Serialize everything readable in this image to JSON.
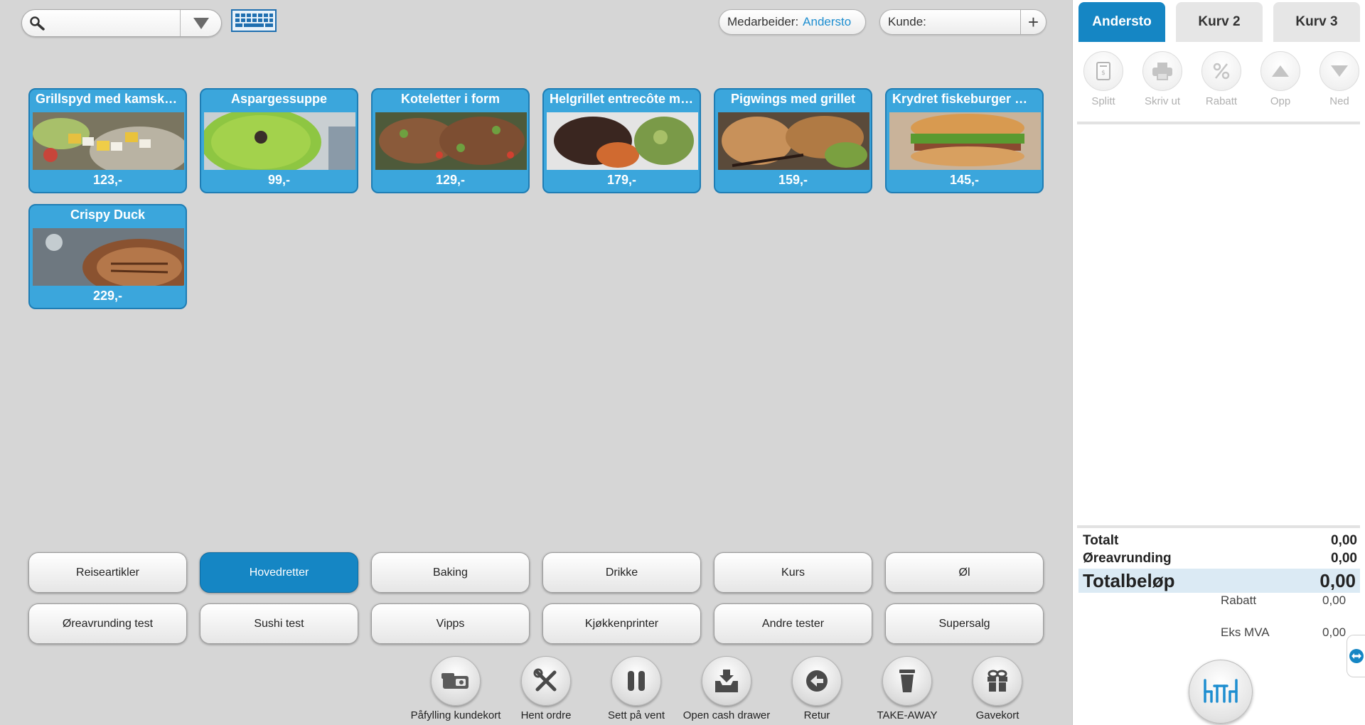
{
  "search": {
    "value": "",
    "placeholder": ""
  },
  "header": {
    "staff_label": "Medarbeider:",
    "staff_name": "Andersto",
    "customer_label": "Kunde:",
    "add_customer": "+"
  },
  "products": [
    {
      "name": "Grillspyd med kamskjell",
      "price": "123,-"
    },
    {
      "name": "Aspargessuppe",
      "price": "99,-"
    },
    {
      "name": "Koteletter i form",
      "price": "129,-"
    },
    {
      "name": "Helgrillet entrecôte med",
      "price": "179,-"
    },
    {
      "name": "Pigwings med grillet",
      "price": "159,-"
    },
    {
      "name": "Krydret fiskeburger med",
      "price": "145,-"
    },
    {
      "name": "Crispy Duck",
      "price": "229,-"
    }
  ],
  "categories": [
    {
      "label": "Reiseartikler"
    },
    {
      "label": "Hovedretter"
    },
    {
      "label": "Baking"
    },
    {
      "label": "Drikke"
    },
    {
      "label": "Kurs"
    },
    {
      "label": "Øl"
    },
    {
      "label": "Øreavrunding test"
    },
    {
      "label": "Sushi test"
    },
    {
      "label": "Vipps"
    },
    {
      "label": "Kjøkkenprinter"
    },
    {
      "label": "Andre tester"
    },
    {
      "label": "Supersalg"
    }
  ],
  "active_category": "Hovedretter",
  "tools": [
    {
      "label": "Påfylling kundekort",
      "icon": "card-refill-icon"
    },
    {
      "label": "Hent ordre",
      "icon": "tools-icon"
    },
    {
      "label": "Sett på vent",
      "icon": "pause-icon"
    },
    {
      "label": "Open cash drawer",
      "icon": "cash-drawer-icon"
    },
    {
      "label": "Retur",
      "icon": "return-icon"
    },
    {
      "label": "TAKE-AWAY",
      "icon": "cup-icon"
    },
    {
      "label": "Gavekort",
      "icon": "gift-icon"
    }
  ],
  "cart_tabs": [
    {
      "label": "Andersto",
      "active": true
    },
    {
      "label": "Kurv 2",
      "active": false
    },
    {
      "label": "Kurv 3",
      "active": false
    }
  ],
  "cart_actions": [
    {
      "label": "Splitt",
      "icon": "receipt-icon"
    },
    {
      "label": "Skriv ut",
      "icon": "printer-icon"
    },
    {
      "label": "Rabatt",
      "icon": "percent-icon"
    },
    {
      "label": "Opp",
      "icon": "arrow-up-icon"
    },
    {
      "label": "Ned",
      "icon": "arrow-down-icon"
    }
  ],
  "summary": {
    "total_label": "Totalt",
    "total_value": "0,00",
    "rounding_label": "Øreavrunding",
    "rounding_value": "0,00",
    "grand_label": "Totalbeløp",
    "grand_value": "0,00",
    "discount_label": "Rabatt",
    "discount_value": "0,00",
    "ex_vat_label": "Eks MVA",
    "ex_vat_value": "0,00"
  },
  "colors": {
    "accent": "#1586c4",
    "tile": "#3ba6dc",
    "background": "#d6d6d6",
    "link": "#1e8ed0"
  }
}
